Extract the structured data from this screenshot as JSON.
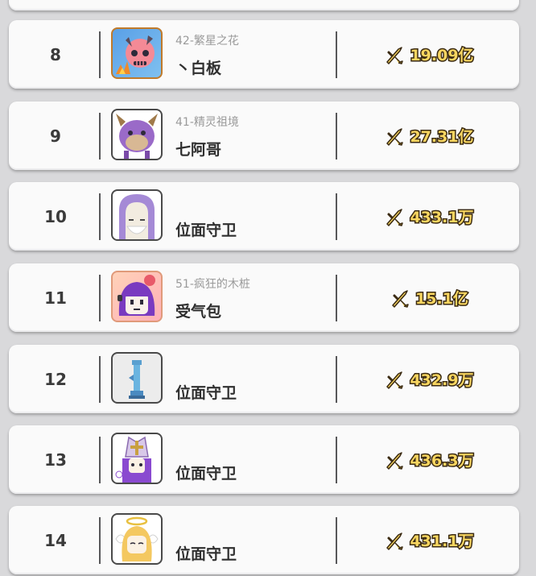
{
  "leaderboard": {
    "rows": [
      {
        "rank": "8",
        "subtitle": "42-繁星之花",
        "name": "丶白板",
        "power": "19.09亿",
        "avatar": "pink-skull-campfire"
      },
      {
        "rank": "9",
        "subtitle": "41-精灵祖境",
        "name": "七阿哥",
        "power": "27.31亿",
        "avatar": "purple-beast"
      },
      {
        "rank": "10",
        "subtitle": "",
        "name": "位面守卫",
        "power": "433.1万",
        "avatar": "hooded-elder"
      },
      {
        "rank": "11",
        "subtitle": "51-疯狂的木桩",
        "name": "受气包",
        "power": "15.1亿",
        "avatar": "purple-hair-girl"
      },
      {
        "rank": "12",
        "subtitle": "",
        "name": "位面守卫",
        "power": "432.9万",
        "avatar": "blue-statue"
      },
      {
        "rank": "13",
        "subtitle": "",
        "name": "位面守卫",
        "power": "436.3万",
        "avatar": "bishop-mitre"
      },
      {
        "rank": "14",
        "subtitle": "",
        "name": "位面守卫",
        "power": "431.1万",
        "avatar": "blonde-angel"
      }
    ]
  },
  "icons": {
    "power": "crossed-swords-icon"
  },
  "colors": {
    "power_text": "#f7d560",
    "power_outline": "#3a2a12",
    "card": "#fafafa",
    "background": "#d9d9db"
  }
}
